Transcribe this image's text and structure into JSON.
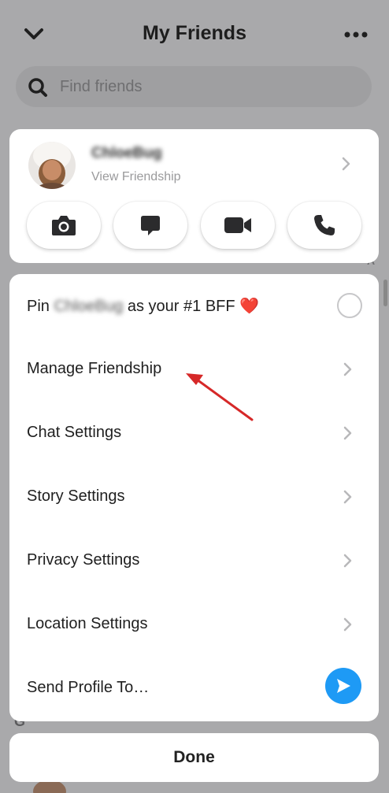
{
  "header": {
    "title": "My Friends",
    "back_icon": "chevron-down-icon",
    "more_icon": "ellipsis-icon"
  },
  "search": {
    "placeholder": "Find friends",
    "icon": "search-icon"
  },
  "friend": {
    "name": "ChloeBug",
    "subtitle": "View Friendship",
    "actions": [
      {
        "icon": "camera-icon"
      },
      {
        "icon": "chat-icon"
      },
      {
        "icon": "video-call-icon"
      },
      {
        "icon": "phone-icon"
      }
    ]
  },
  "menu": {
    "pin": {
      "prefix": "Pin",
      "name": "ChloeBug",
      "suffix": "as your #1 BFF",
      "emoji": "❤️"
    },
    "items": [
      {
        "label": "Manage Friendship"
      },
      {
        "label": "Chat Settings"
      },
      {
        "label": "Story Settings"
      },
      {
        "label": "Privacy Settings"
      },
      {
        "label": "Location Settings"
      }
    ],
    "send_profile": {
      "label": "Send Profile To…",
      "icon": "send-arrow-icon"
    }
  },
  "background": {
    "section_letter_a": "A",
    "section_letter_g": "G"
  },
  "done": {
    "label": "Done"
  },
  "colors": {
    "overlay": "#a9a9ab",
    "card": "#ffffff",
    "send_blue": "#1e9af5",
    "annotation_arrow": "#d62828",
    "heart": "#d9232d"
  }
}
